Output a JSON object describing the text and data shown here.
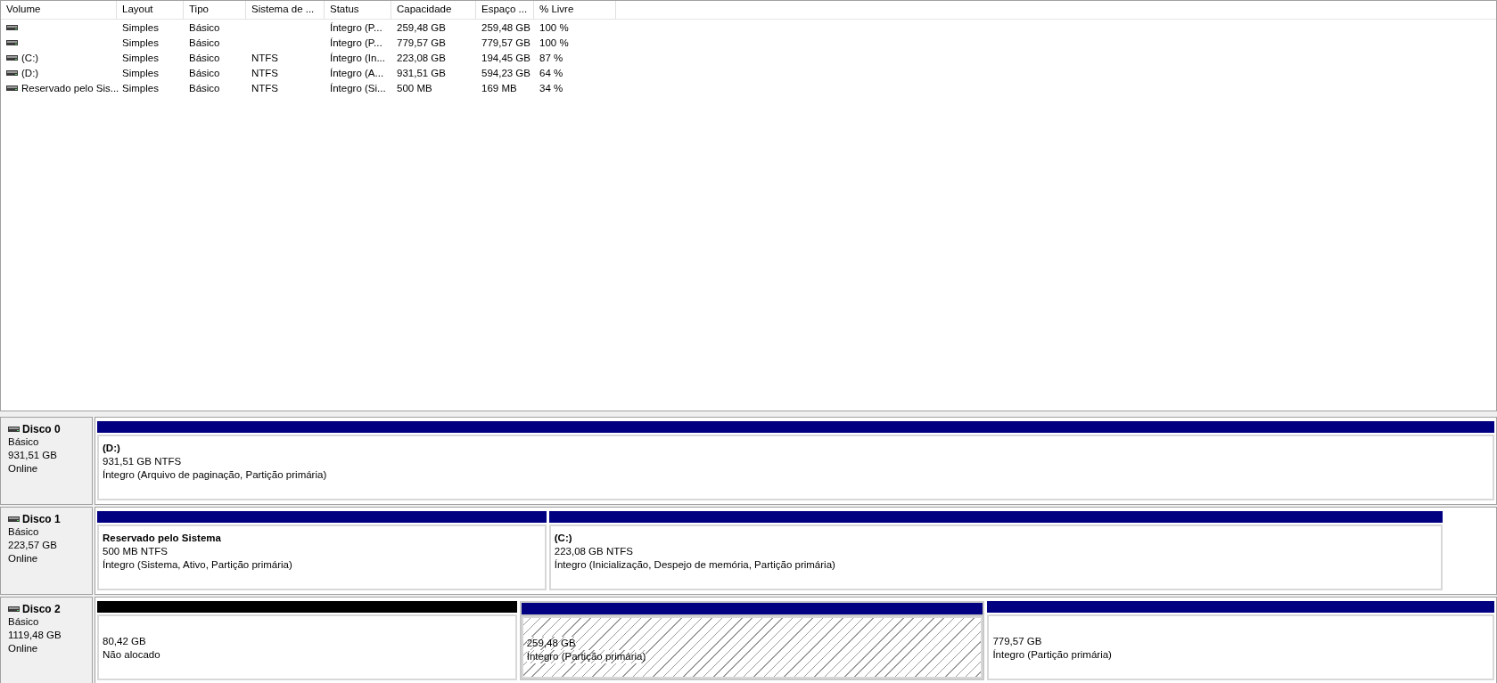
{
  "volume_table": {
    "columns": [
      "Volume",
      "Layout",
      "Tipo",
      "Sistema de ...",
      "Status",
      "Capacidade",
      "Espaço ...",
      "% Livre"
    ],
    "rows": [
      {
        "cells": [
          "",
          "Simples",
          "Básico",
          "",
          "Íntegro (P...",
          "259,48 GB",
          "259,48 GB",
          "100 %"
        ]
      },
      {
        "cells": [
          "",
          "Simples",
          "Básico",
          "",
          "Íntegro (P...",
          "779,57 GB",
          "779,57 GB",
          "100 %"
        ]
      },
      {
        "cells": [
          "(C:)",
          "Simples",
          "Básico",
          "NTFS",
          "Íntegro (In...",
          "223,08 GB",
          "194,45 GB",
          "87 %"
        ]
      },
      {
        "cells": [
          "(D:)",
          "Simples",
          "Básico",
          "NTFS",
          "Íntegro (A...",
          "931,51 GB",
          "594,23 GB",
          "64 %"
        ]
      },
      {
        "cells": [
          "Reservado pelo Sis...",
          "Simples",
          "Básico",
          "NTFS",
          "Íntegro (Si...",
          "500 MB",
          "169 MB",
          "34 %"
        ]
      }
    ]
  },
  "disks": [
    {
      "name": "Disco 0",
      "type": "Básico",
      "size": "931,51 GB",
      "status": "Online",
      "partitions": [
        {
          "kind": "primary",
          "selected": false,
          "name": "(D:)",
          "size": "931,51 GB NTFS",
          "status": "Íntegro (Arquivo de paginação, Partição primária)"
        }
      ]
    },
    {
      "name": "Disco 1",
      "type": "Básico",
      "size": "223,57 GB",
      "status": "Online",
      "partitions": [
        {
          "kind": "primary",
          "selected": false,
          "name": "Reservado pelo Sistema",
          "size": "500 MB NTFS",
          "status": "Íntegro (Sistema, Ativo, Partição primária)"
        },
        {
          "kind": "primary",
          "selected": false,
          "name": "(C:)",
          "size": "223,08 GB NTFS",
          "status": "Íntegro (Inicialização, Despejo de memória, Partição primária)"
        }
      ]
    },
    {
      "name": "Disco 2",
      "type": "Básico",
      "size": "1119,48 GB",
      "status": "Online",
      "partitions": [
        {
          "kind": "unallocated",
          "selected": false,
          "size": "80,42 GB",
          "status": "Não alocado"
        },
        {
          "kind": "primary",
          "selected": true,
          "size": "259,48 GB",
          "status": "Íntegro (Partição primária)"
        },
        {
          "kind": "primary",
          "selected": false,
          "size": "779,57 GB",
          "status": "Íntegro (Partição primária)"
        }
      ]
    }
  ]
}
